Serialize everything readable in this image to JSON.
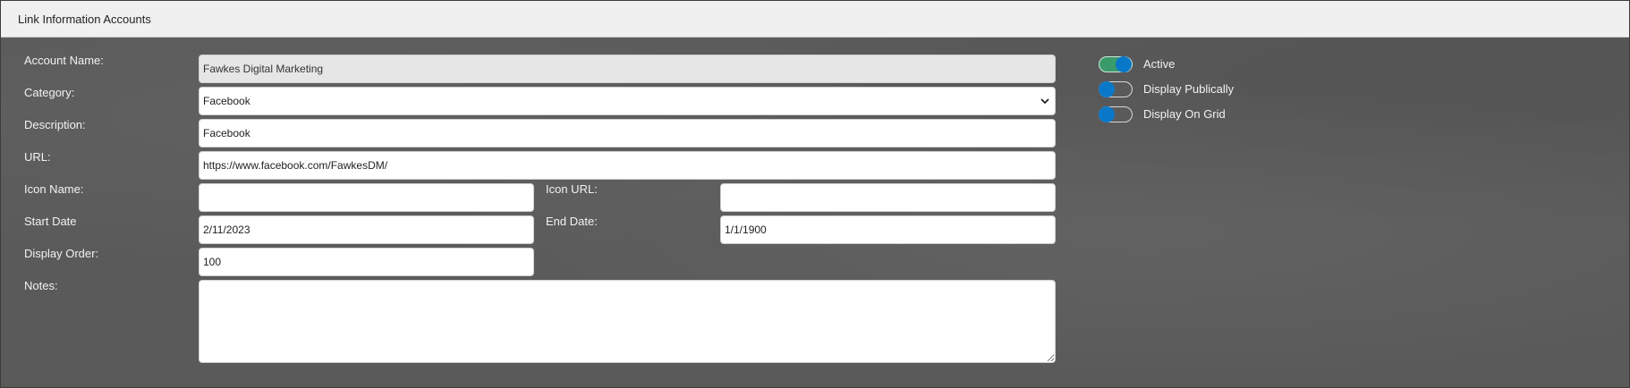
{
  "panel": {
    "title": "Link Information Accounts"
  },
  "form": {
    "account_name": {
      "label": "Account Name:",
      "value": "Fawkes Digital Marketing"
    },
    "category": {
      "label": "Category:",
      "value": "Facebook"
    },
    "description": {
      "label": "Description:",
      "value": "Facebook"
    },
    "url": {
      "label": "URL:",
      "value": "https://www.facebook.com/FawkesDM/"
    },
    "icon_name": {
      "label": "Icon Name:",
      "value": ""
    },
    "icon_url": {
      "label": "Icon URL:",
      "value": ""
    },
    "start_date": {
      "label": "Start Date",
      "value": "2/11/2023"
    },
    "end_date": {
      "label": "End Date:",
      "value": "1/1/1900"
    },
    "display_order": {
      "label": "Display Order:",
      "value": "100"
    },
    "notes": {
      "label": "Notes:",
      "value": ""
    }
  },
  "toggles": [
    {
      "label": "Active",
      "on": true
    },
    {
      "label": "Display Publically",
      "on": false
    },
    {
      "label": "Display On Grid",
      "on": false
    }
  ],
  "colors": {
    "panel_bg": "#5a5a5a",
    "toggle_knob": "#0a78c8",
    "toggle_on_track": "#3a9a6a"
  },
  "icons": {
    "category_dropdown": "chevron-down-icon"
  }
}
